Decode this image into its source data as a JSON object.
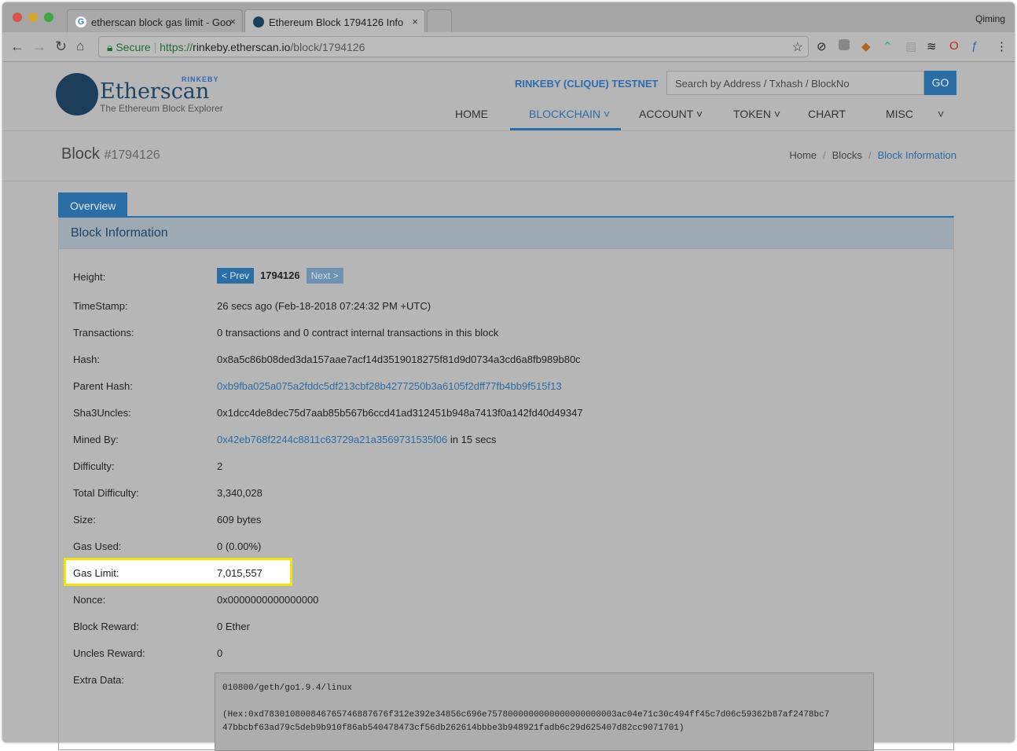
{
  "browser": {
    "tabs": [
      {
        "label": "etherscan block gas limit - Goo"
      },
      {
        "label": "Ethereum Block 1794126 Info"
      }
    ],
    "user": "Qiming",
    "secure_label": "Secure",
    "url_scheme": "https://",
    "url_host": "rinkeby.etherscan.io",
    "url_path": "/block/1794126"
  },
  "site": {
    "logo_name": "Etherscan",
    "logo_sub": "The Ethereum Block Explorer",
    "logo_badge": "RINKEBY",
    "network": "RINKEBY (CLIQUE) TESTNET",
    "search_placeholder": "Search by Address / Txhash / BlockNo",
    "go": "GO",
    "menu": [
      "HOME",
      "BLOCKCHAIN",
      "ACCOUNT",
      "TOKEN",
      "CHART",
      "MISC"
    ]
  },
  "page": {
    "title": "Block",
    "block_no": "#1794126",
    "breadcrumb": [
      "Home",
      "Blocks",
      "Block Information"
    ],
    "tab": "Overview",
    "panel_title": "Block Information"
  },
  "block": {
    "rows": [
      {
        "label": "Height:",
        "value": "1794126",
        "prev": "< Prev",
        "next": "Next >"
      },
      {
        "label": "TimeStamp:",
        "value": "26 secs ago (Feb-18-2018 07:24:32 PM +UTC)"
      },
      {
        "label": "Transactions:",
        "value": "0 transactions and 0 contract internal transactions in this block"
      },
      {
        "label": "Hash:",
        "value": "0x8a5c86b08ded3da157aae7acf14d3519018275f81d9d0734a3cd6a8fb989b80c"
      },
      {
        "label": "Parent Hash:",
        "value": "0xb9fba025a075a2fddc5df213cbf28b4277250b3a6105f2dff77fb4bb9f515f13"
      },
      {
        "label": "Sha3Uncles:",
        "value": "0x1dcc4de8dec75d7aab85b567b6ccd41ad312451b948a7413f0a142fd40d49347"
      },
      {
        "label": "Mined By:",
        "value": "0x42eb768f2244c8811c63729a21a3569731535f06",
        "suffix": " in 15 secs"
      },
      {
        "label": "Difficulty:",
        "value": "2"
      },
      {
        "label": "Total Difficulty:",
        "value": "3,340,028"
      },
      {
        "label": "Size:",
        "value": "609 bytes"
      },
      {
        "label": "Gas Used:",
        "value": "0 (0.00%)"
      },
      {
        "label": "Gas Limit:",
        "value": "7,015,557"
      },
      {
        "label": "Nonce:",
        "value": "0x0000000000000000"
      },
      {
        "label": "Block Reward:",
        "value": "0 Ether"
      },
      {
        "label": "Uncles Reward:",
        "value": "0"
      },
      {
        "label": "Extra Data:",
        "value": "010800/geth/go1.9.4/linux",
        "hex1": "(Hex:0xd783010800846765746887676f312e392e34856c696e7578000000000000000000003ac04e71c30c494ff45c7d06c59362b87af2478bc7",
        "hex2": "47bbcbf63ad79c5deb9b910f86ab540478473cf56db262614bbbe3b948921fadb6c29d625407d82cc9071701)"
      }
    ]
  }
}
